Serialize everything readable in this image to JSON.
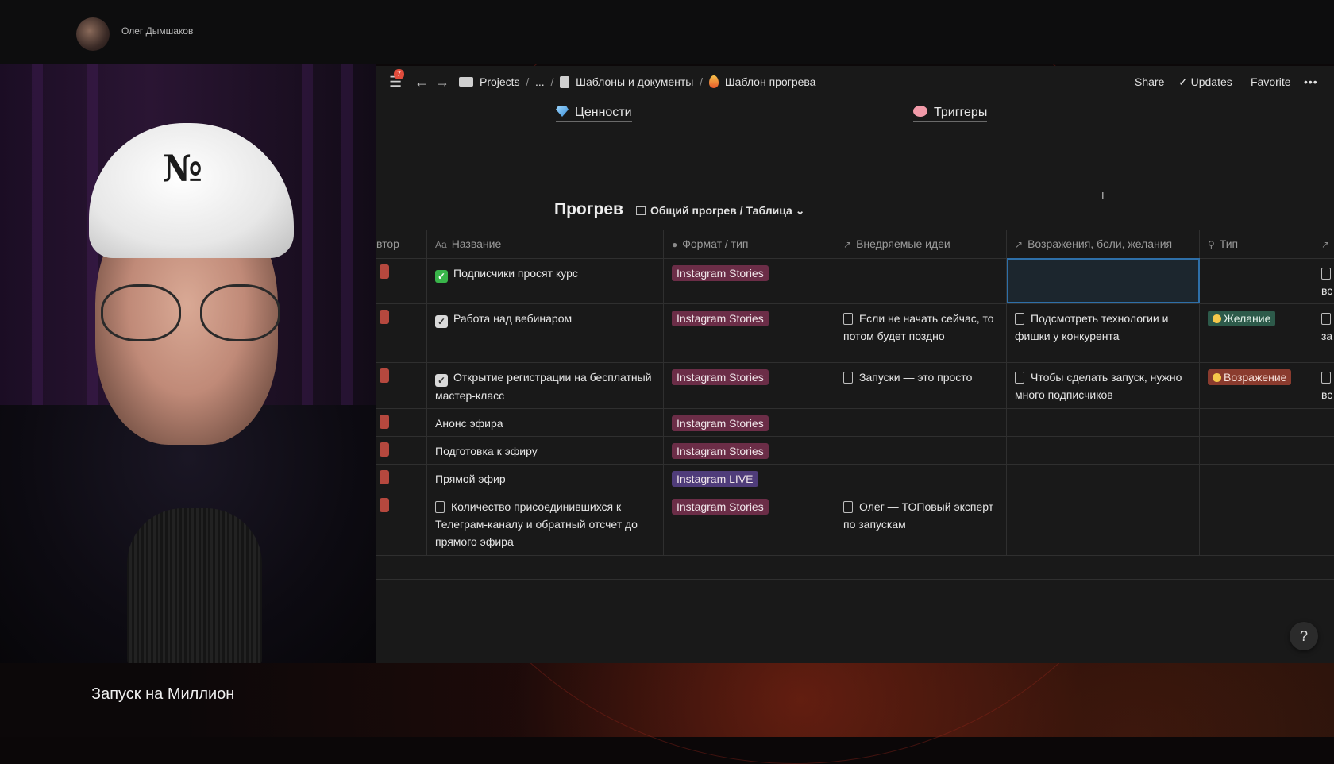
{
  "stream": {
    "host_name": "Олег Дымшаков",
    "caption": "Запуск на Миллион"
  },
  "nav": {
    "notifications_count": "7",
    "breadcrumbs": [
      "Projects",
      "...",
      "Шаблоны и документы",
      "Шаблон прогрева"
    ],
    "actions": {
      "share": "Share",
      "updates": "Updates",
      "favorite": "Favorite",
      "more": "•••"
    }
  },
  "links": [
    {
      "label": "Ценности",
      "icon": "gem-icon"
    },
    {
      "label": "Триггеры",
      "icon": "brain-icon"
    }
  ],
  "database": {
    "title": "Прогрев",
    "view_label": "Общий прогрев / Таблица"
  },
  "columns": [
    {
      "label": "втор",
      "icon": ""
    },
    {
      "label": "Название",
      "icon": "Aa"
    },
    {
      "label": "Формат / тип",
      "icon": "●"
    },
    {
      "label": "Внедряемые идеи",
      "icon": "↗"
    },
    {
      "label": "Возражения, боли, желания",
      "icon": "↗"
    },
    {
      "label": "Тип",
      "icon": "⚲"
    },
    {
      "label": "",
      "icon": "↗"
    }
  ],
  "rows": [
    {
      "name": "Подписчики просят курс",
      "check": "green",
      "format": "Instagram Stories",
      "format_kind": "stories",
      "idea": "",
      "objection": "",
      "type": "",
      "type_kind": "",
      "extra": "вс"
    },
    {
      "name": "Работа над вебинаром",
      "check": "grey",
      "format": "Instagram Stories",
      "format_kind": "stories",
      "idea": "Если не начать сейчас, то потом будет поздно",
      "objection": "Подсмотреть технологии и фишки у конкурента",
      "type": "Желание",
      "type_kind": "wish",
      "extra": "за"
    },
    {
      "name": "Открытие регистрации на бесплатный мастер-класс",
      "check": "grey",
      "format": "Instagram Stories",
      "format_kind": "stories",
      "idea": "Запуски — это просто",
      "objection": "Чтобы сделать запуск, нужно много подписчиков",
      "type": "Возражение",
      "type_kind": "obj",
      "extra": "вс"
    },
    {
      "name": "Анонс эфира",
      "check": "",
      "format": "Instagram Stories",
      "format_kind": "stories",
      "idea": "",
      "objection": "",
      "type": "",
      "type_kind": "",
      "extra": ""
    },
    {
      "name": "Подготовка к эфиру",
      "check": "",
      "format": "Instagram Stories",
      "format_kind": "stories",
      "idea": "",
      "objection": "",
      "type": "",
      "type_kind": "",
      "extra": ""
    },
    {
      "name": "Прямой эфир",
      "check": "",
      "format": "Instagram LIVE",
      "format_kind": "live",
      "idea": "",
      "objection": "",
      "type": "",
      "type_kind": "",
      "extra": ""
    },
    {
      "name": "Количество присоединившихся к Телеграм-каналу и обратный отсчет до прямого эфира",
      "check": "doc",
      "format": "Instagram Stories",
      "format_kind": "stories",
      "idea": "Олег — ТОПовый эксперт по запускам",
      "objection": "",
      "type": "",
      "type_kind": "",
      "extra": ""
    }
  ],
  "help_label": "?",
  "colors": {
    "stories_tag": "#6b2d47",
    "live_tag": "#4f3c7a",
    "wish_tag": "#2d5a4a",
    "objection_tag": "#8a3b2e",
    "selection": "#2e6fa8"
  }
}
